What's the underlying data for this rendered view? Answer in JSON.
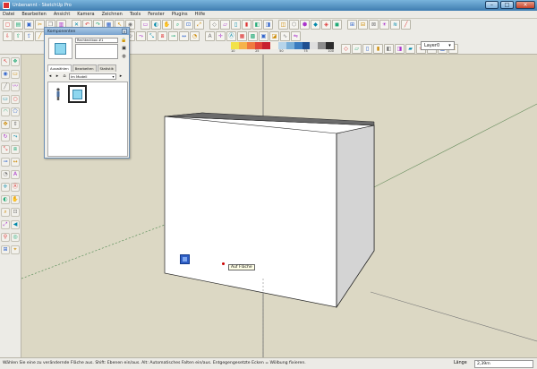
{
  "window": {
    "title": "Unbenannt - SketchUp Pro",
    "controls": [
      "–",
      "□",
      "×"
    ]
  },
  "menu": [
    "Datei",
    "Bearbeiten",
    "Ansicht",
    "Kamera",
    "Zeichnen",
    "Tools",
    "Fenster",
    "Plugins",
    "Hilfe"
  ],
  "toolbar": {
    "layer_select_value": "Layer0",
    "style_legend": [
      "10",
      "25",
      "50",
      "75",
      "100"
    ],
    "style_colors": [
      "#f2e24a",
      "#f6b34a",
      "#f07a3f",
      "#e24438",
      "#c8202e",
      "#f3f0e7",
      "#b6d4ea",
      "#78aed8",
      "#3b7cc0",
      "#1f4f91",
      "#dfdfdf",
      "#8d8d8d",
      "#2c2c2c"
    ]
  },
  "components": {
    "title": "Komponenten",
    "name_value": "Rechteckbox #1",
    "tabs": [
      "Auswählen",
      "Bearbeiten",
      "Statistik"
    ],
    "collection": "Im Modell"
  },
  "viewport": {
    "tooltip": "Auf Fläche"
  },
  "status": {
    "text": "Wählen Sie eine zu verändernde Fläche aus. Shift: Ebenen ein/aus. Alt: Automatisches Falten ein/aus. Entgegengesetzte Ecken = Wölbung fixieren.",
    "measure_label": "Länge",
    "measure_value": "2,39m"
  },
  "icons": {
    "left_toolbar": [
      "select-icon",
      "component-icon",
      "paint-icon",
      "eraser-icon",
      "line-icon",
      "freehand-icon",
      "rectangle-icon",
      "circle-icon",
      "arc-icon",
      "polygon-icon",
      "move-icon",
      "pushpull-icon",
      "rotate-icon",
      "followme-icon",
      "scale-icon",
      "offset-icon",
      "tape-icon",
      "dimension-icon",
      "protractor-icon",
      "text-icon",
      "axes-icon",
      "3dtext-icon",
      "orbit-icon",
      "pan-icon",
      "zoom-icon",
      "zoomwindow-icon",
      "zoomextents-icon",
      "previous-icon",
      "walk-icon",
      "lookaround-icon",
      "section-icon",
      "position-camera-icon"
    ],
    "top_row1": [
      "new-icon",
      "open-icon",
      "save-icon",
      "cut-icon",
      "copy-icon",
      "paste-icon",
      "erase-icon",
      "undo-icon",
      "redo-icon",
      "print-icon",
      "select-icon",
      "paint-icon",
      "eraser-icon",
      "orbit-icon",
      "pan-icon",
      "zoom-icon",
      "zoom-window-icon",
      "zoom-extents-icon",
      "iso-icon",
      "top-icon",
      "front-icon",
      "right-icon",
      "back-icon",
      "left-icon",
      "xray-icon",
      "wireframe-icon",
      "hidden-line-icon",
      "shaded-icon",
      "shaded-texture-icon",
      "monochrome-icon",
      "section-plane-icon",
      "section-display-icon",
      "section-cut-icon",
      "shadow-icon",
      "fog-icon",
      "edge-icon"
    ],
    "top_row2": [
      "get-models-icon",
      "share-model-icon",
      "share-component-icon",
      "line-icon",
      "arc-icon",
      "freehand-icon",
      "rectangle-icon",
      "circle-icon",
      "polygon-icon",
      "move-icon",
      "pushpull-icon",
      "rotate-icon",
      "followme-icon",
      "scale-icon",
      "offset-icon",
      "tape-icon",
      "dimension-icon",
      "protractor-icon",
      "text-icon",
      "axes-icon",
      "3dtext-icon",
      "sandbox-icon",
      "sandbox-scratch-icon",
      "stamp-icon",
      "drape-icon",
      "smoove-icon",
      "flip-icon"
    ],
    "top_row3": [
      "iso-view-icon",
      "top-view-icon",
      "front-view-icon",
      "right-view-icon",
      "back-view-icon",
      "left-view-icon",
      "bottom-view-icon",
      "shadow-settings-icon",
      "fog-settings-icon",
      "match-photo-icon",
      "layer-manager-icon"
    ]
  }
}
